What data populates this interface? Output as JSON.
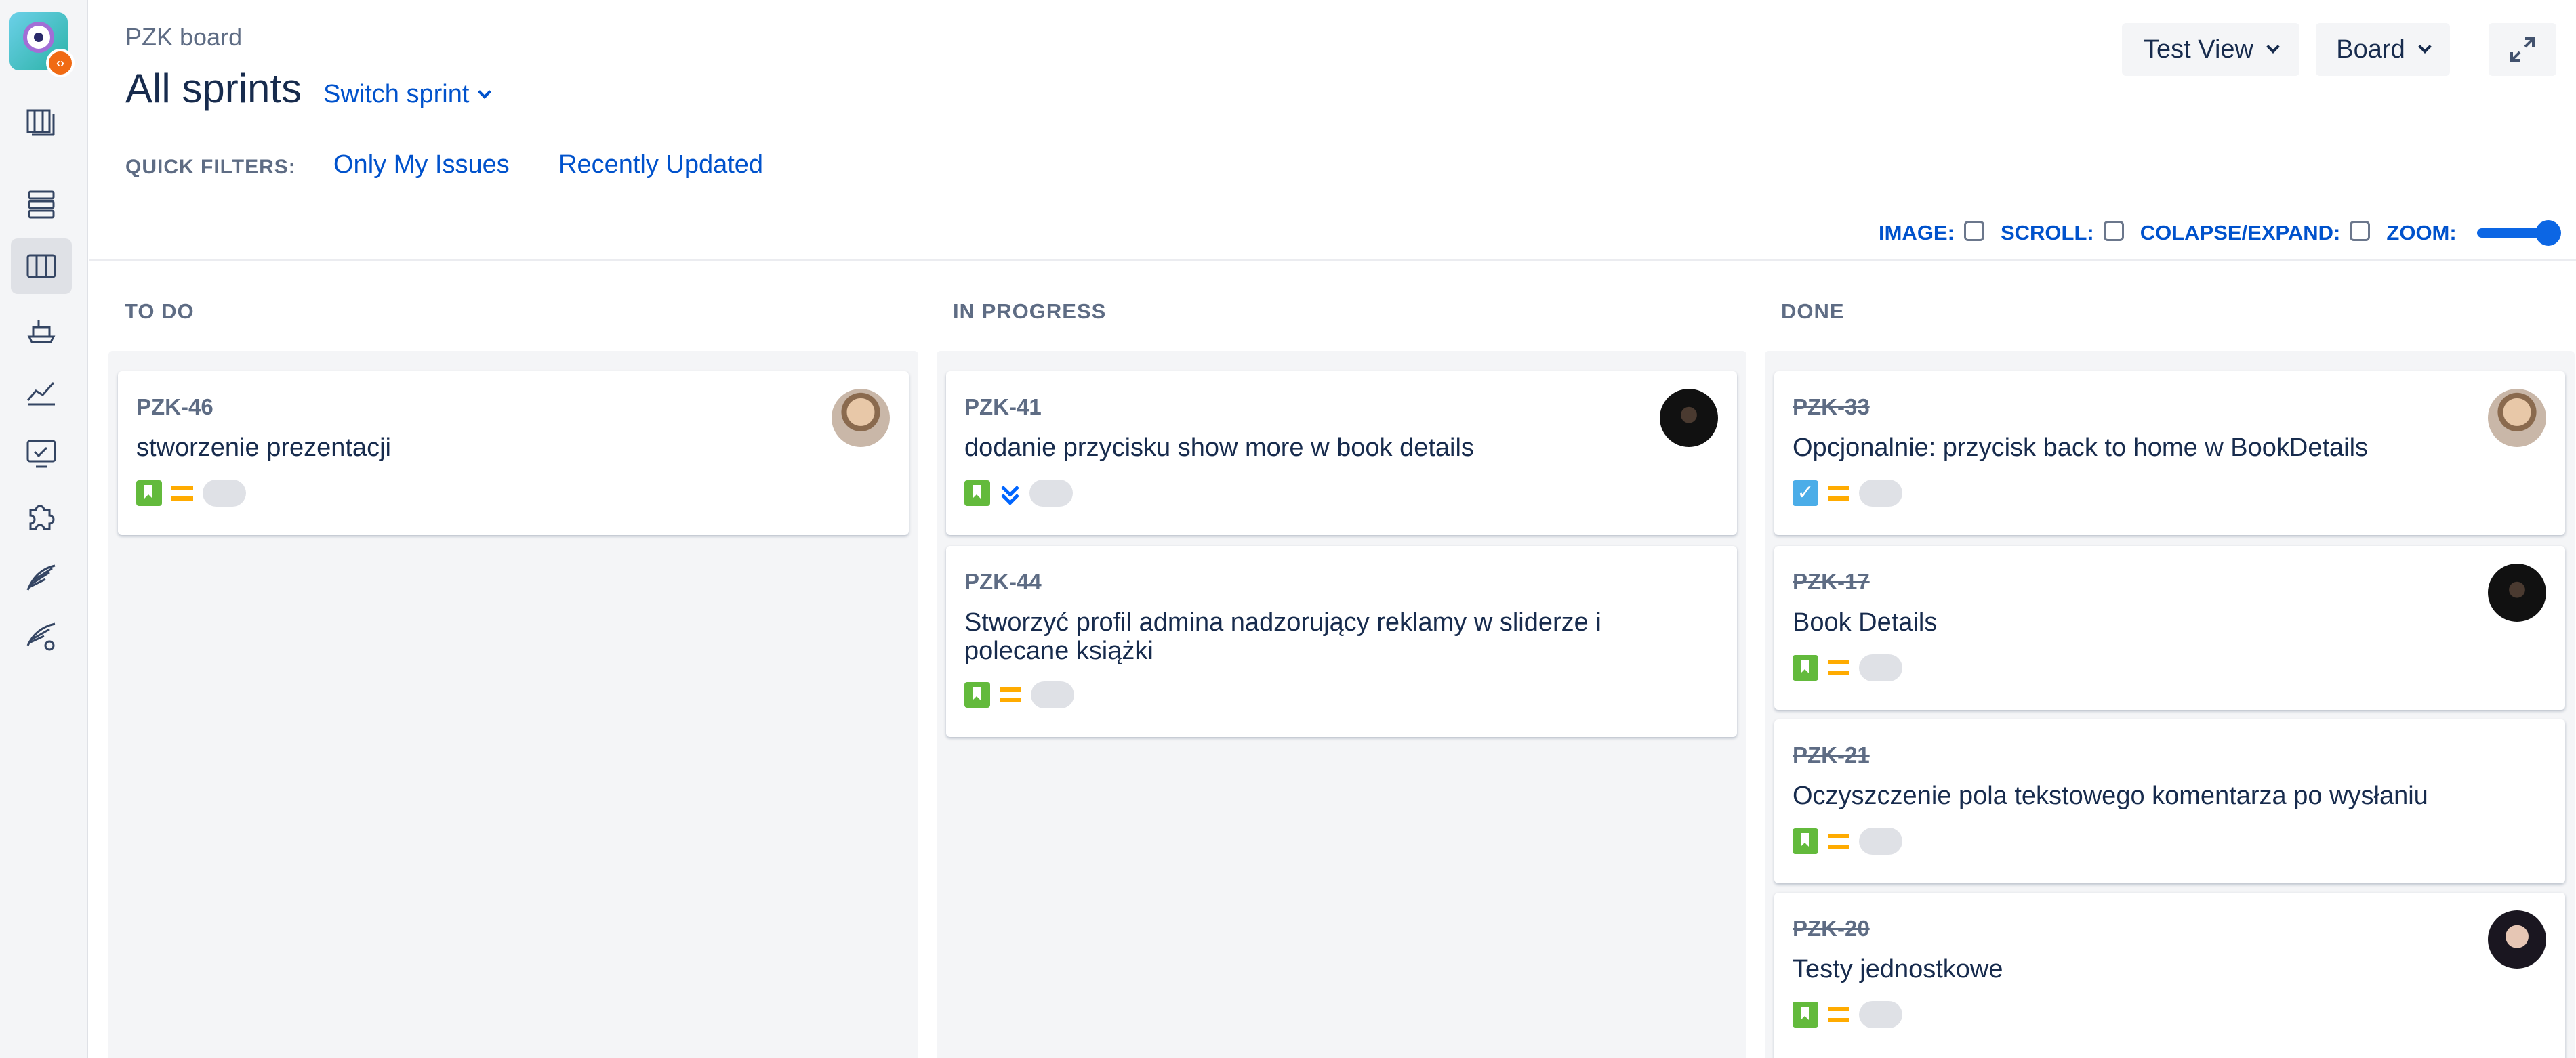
{
  "sidebar": {
    "logo_icon": "app-logo-icon",
    "items": [
      {
        "icon": "roadmap-icon",
        "active": false
      },
      {
        "icon": "backlog-icon",
        "active": false
      },
      {
        "icon": "board-icon",
        "active": true
      },
      {
        "icon": "releases-icon",
        "active": false
      },
      {
        "icon": "reports-icon",
        "active": false
      },
      {
        "icon": "issues-icon",
        "active": false
      },
      {
        "icon": "addons-icon",
        "active": false
      },
      {
        "icon": "wing-icon",
        "active": false
      },
      {
        "icon": "wing-settings-icon",
        "active": false
      }
    ]
  },
  "header": {
    "project_name": "PZK board",
    "title": "All sprints",
    "switch_sprint": "Switch sprint",
    "test_view": "Test View",
    "board": "Board"
  },
  "quick_filters": {
    "label": "QUICK FILTERS:",
    "items": [
      "Only My Issues",
      "Recently Updated"
    ]
  },
  "options": {
    "image": "IMAGE:",
    "scroll": "SCROLL:",
    "collapse": "COLAPSE/EXPAND:",
    "zoom": "ZOOM:",
    "zoom_level": 1.0
  },
  "columns": [
    {
      "title": "TO DO"
    },
    {
      "title": "IN PROGRESS"
    },
    {
      "title": "DONE"
    }
  ],
  "cards": {
    "todo": [
      {
        "key": "PZK-46",
        "summary": "stworzenie prezentacji",
        "type": "story",
        "priority": "medium"
      }
    ],
    "inprogress": [
      {
        "key": "PZK-41",
        "summary": "dodanie przycisku show more w book details",
        "type": "story",
        "priority": "low"
      },
      {
        "key": "PZK-44",
        "summary": "Stworzyć profil admina nadzorujący reklamy w sliderze i polecane książki",
        "type": "story",
        "priority": "medium"
      }
    ],
    "done": [
      {
        "key": "PZK-33",
        "summary": "Opcjonalnie: przycisk back to home w BookDetails",
        "type": "task",
        "priority": "medium"
      },
      {
        "key": "PZK-17",
        "summary": "Book Details",
        "type": "story",
        "priority": "medium"
      },
      {
        "key": "PZK-21",
        "summary": "Oczyszczenie pola tekstowego komentarza po wysłaniu",
        "type": "story",
        "priority": "medium"
      },
      {
        "key": "PZK-20",
        "summary": "Testy jednostkowe",
        "type": "story",
        "priority": "medium"
      }
    ]
  },
  "colors": {
    "link": "#0052cc",
    "story": "#63ba3c",
    "task": "#4bade8",
    "priority_medium": "#ffab00",
    "priority_low": "#0065ff"
  }
}
